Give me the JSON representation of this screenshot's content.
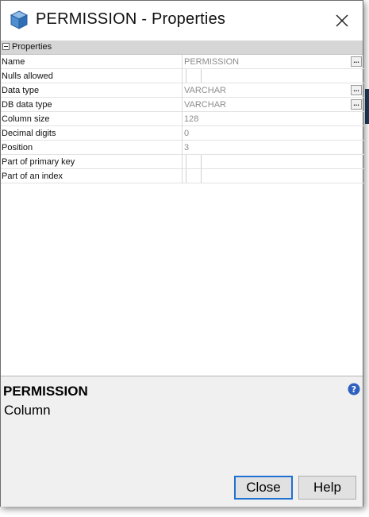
{
  "window": {
    "title": "PERMISSION - Properties"
  },
  "grid": {
    "category": "Properties",
    "rows": [
      {
        "name": "Name",
        "value": "PERMISSION",
        "has_button": true
      },
      {
        "name": "Nulls allowed",
        "value": "",
        "checkbox": true
      },
      {
        "name": "Data type",
        "value": "VARCHAR",
        "has_button": true
      },
      {
        "name": "DB data type",
        "value": "VARCHAR",
        "has_button": true
      },
      {
        "name": "Column size",
        "value": "128"
      },
      {
        "name": "Decimal digits",
        "value": "0"
      },
      {
        "name": "Position",
        "value": "3"
      },
      {
        "name": "Part of primary key",
        "value": "",
        "checkbox": true
      },
      {
        "name": "Part of an index",
        "value": "",
        "checkbox": true
      }
    ],
    "ellipsis_label": "..."
  },
  "description": {
    "title": "PERMISSION",
    "subtitle": "Column"
  },
  "buttons": {
    "close": "Close",
    "help": "Help"
  },
  "colors": {
    "accent": "#1e70d2",
    "help_icon": "#2f5fbf",
    "icon_blue": "#3b78c4"
  }
}
